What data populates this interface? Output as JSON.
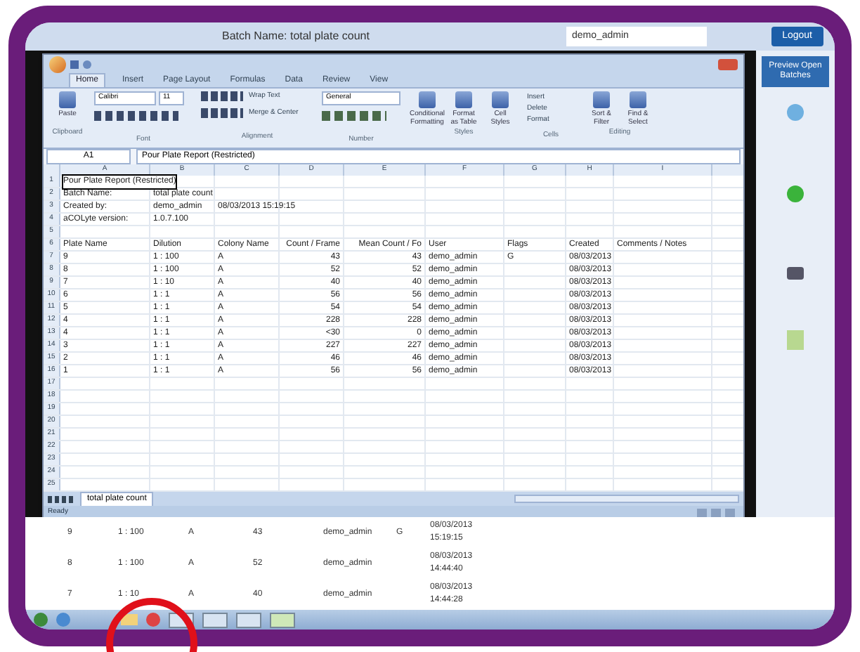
{
  "header": {
    "batch_label": "Batch Name: total plate count",
    "user": "demo_admin",
    "logout": "Logout"
  },
  "excel": {
    "tabs": [
      {
        "label": "Home",
        "selected": true
      },
      {
        "label": "Insert",
        "selected": false
      },
      {
        "label": "Page Layout",
        "selected": false
      },
      {
        "label": "Formulas",
        "selected": false
      },
      {
        "label": "Data",
        "selected": false
      },
      {
        "label": "Review",
        "selected": false
      },
      {
        "label": "View",
        "selected": false
      }
    ],
    "ribbon": {
      "font": "Calibri",
      "size": "11",
      "number_format": "General",
      "paste": "Paste",
      "wrap": "Wrap Text",
      "merge": "Merge & Center",
      "styles": [
        "Conditional Formatting",
        "Format as Table",
        "Cell Styles"
      ],
      "cells": [
        "Insert",
        "Delete",
        "Format"
      ],
      "editing": [
        "Sort & Filter",
        "Find & Select"
      ],
      "groups": [
        "Clipboard",
        "Font",
        "Alignment",
        "Number",
        "Styles",
        "Cells",
        "Editing"
      ]
    },
    "name_box": "A1",
    "formula": "Pour Plate Report (Restricted)",
    "columns": [
      "A",
      "B",
      "C",
      "D",
      "E",
      "F",
      "G",
      "H",
      "I"
    ],
    "rows": [
      {
        "number": "1",
        "cells": {
          "A": "Pour Plate Report (Restricted)"
        }
      },
      {
        "number": "2",
        "cells": {
          "A": "Batch Name:",
          "B": "total plate count"
        }
      },
      {
        "number": "3",
        "cells": {
          "A": "Created by:",
          "B": "demo_admin",
          "C": "08/03/2013 15:19:15"
        }
      },
      {
        "number": "4",
        "cells": {
          "A": "aCOLyte version:",
          "B": "1.0.7.100"
        }
      },
      {
        "number": "5",
        "cells": {}
      },
      {
        "number": "6",
        "cells": {
          "A": "Plate Name",
          "B": "Dilution",
          "C": "Colony Name",
          "D": "Count / Frame",
          "E": "Mean Count / Fo",
          "F": "User",
          "G": "Flags",
          "H": "Created",
          "I": "Comments / Notes"
        }
      },
      {
        "number": "7",
        "cells": {
          "A": "9",
          "B": "1 : 100",
          "C": "A",
          "D": "43",
          "E": "43",
          "F": "demo_admin",
          "G": "G",
          "H": "08/03/2013"
        }
      },
      {
        "number": "8",
        "cells": {
          "A": "8",
          "B": "1 : 100",
          "C": "A",
          "D": "52",
          "E": "52",
          "F": "demo_admin",
          "H": "08/03/2013"
        }
      },
      {
        "number": "9",
        "cells": {
          "A": "7",
          "B": "1 : 10",
          "C": "A",
          "D": "40",
          "E": "40",
          "F": "demo_admin",
          "H": "08/03/2013"
        }
      },
      {
        "number": "10",
        "cells": {
          "A": "6",
          "B": "1 : 1",
          "C": "A",
          "D": "56",
          "E": "56",
          "F": "demo_admin",
          "H": "08/03/2013"
        }
      },
      {
        "number": "11",
        "cells": {
          "A": "5",
          "B": "1 : 1",
          "C": "A",
          "D": "54",
          "E": "54",
          "F": "demo_admin",
          "H": "08/03/2013"
        }
      },
      {
        "number": "12",
        "cells": {
          "A": "4",
          "B": "1 : 1",
          "C": "A",
          "D": "228",
          "E": "228",
          "F": "demo_admin",
          "H": "08/03/2013"
        }
      },
      {
        "number": "13",
        "cells": {
          "A": "4",
          "B": "1 : 1",
          "C": "A",
          "D": "<30",
          "E": "0",
          "F": "demo_admin",
          "H": "08/03/2013"
        }
      },
      {
        "number": "14",
        "cells": {
          "A": "3",
          "B": "1 : 1",
          "C": "A",
          "D": "227",
          "E": "227",
          "F": "demo_admin",
          "H": "08/03/2013"
        }
      },
      {
        "number": "15",
        "cells": {
          "A": "2",
          "B": "1 : 1",
          "C": "A",
          "D": "46",
          "E": "46",
          "F": "demo_admin",
          "H": "08/03/2013"
        }
      },
      {
        "number": "16",
        "cells": {
          "A": "1",
          "B": "1 : 1",
          "C": "A",
          "D": "56",
          "E": "56",
          "F": "demo_admin",
          "H": "08/03/2013"
        }
      },
      {
        "number": "17",
        "cells": {}
      },
      {
        "number": "18",
        "cells": {}
      },
      {
        "number": "19",
        "cells": {}
      },
      {
        "number": "20",
        "cells": {}
      },
      {
        "number": "21",
        "cells": {}
      },
      {
        "number": "22",
        "cells": {}
      },
      {
        "number": "23",
        "cells": {}
      },
      {
        "number": "24",
        "cells": {}
      },
      {
        "number": "25",
        "cells": {}
      }
    ],
    "sheet_tab": "total plate count",
    "status": "Ready"
  },
  "sidebar": {
    "preview": "Preview Open Batches"
  },
  "results": [
    {
      "plate": "9",
      "dilution": "1 : 100",
      "colony": "A",
      "count": "43",
      "user": "demo_admin",
      "flag": "G",
      "date": "08/03/2013",
      "time": "15:19:15"
    },
    {
      "plate": "8",
      "dilution": "1 : 100",
      "colony": "A",
      "count": "52",
      "user": "demo_admin",
      "date": "08/03/2013",
      "time": "14:44:40"
    },
    {
      "plate": "7",
      "dilution": "1 : 10",
      "colony": "A",
      "count": "40",
      "user": "demo_admin",
      "date": "08/03/2013",
      "time": "14:44:28"
    }
  ]
}
